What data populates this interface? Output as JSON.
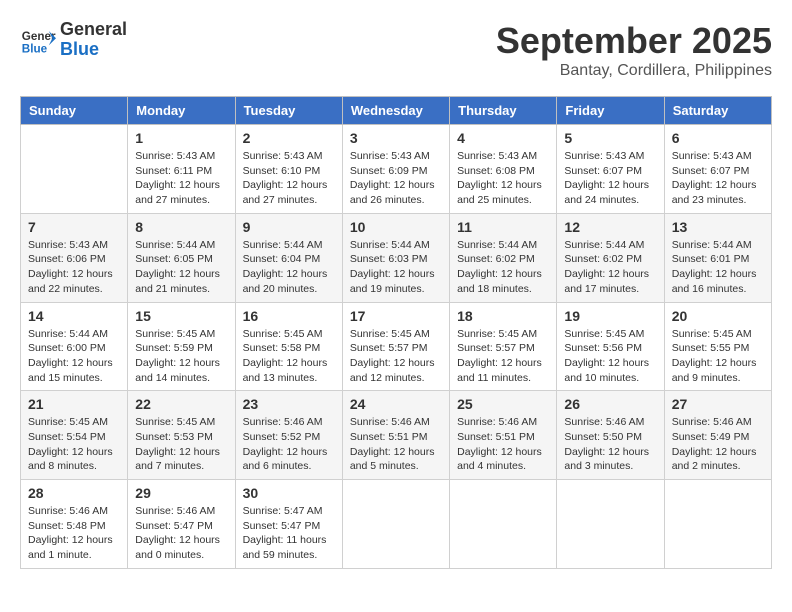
{
  "logo": {
    "text_general": "General",
    "text_blue": "Blue"
  },
  "header": {
    "month": "September 2025",
    "location": "Bantay, Cordillera, Philippines"
  },
  "days_of_week": [
    "Sunday",
    "Monday",
    "Tuesday",
    "Wednesday",
    "Thursday",
    "Friday",
    "Saturday"
  ],
  "weeks": [
    [
      {
        "day": "",
        "sunrise": "",
        "sunset": "",
        "daylight": "",
        "empty": true
      },
      {
        "day": "1",
        "sunrise": "Sunrise: 5:43 AM",
        "sunset": "Sunset: 6:11 PM",
        "daylight": "Daylight: 12 hours and 27 minutes."
      },
      {
        "day": "2",
        "sunrise": "Sunrise: 5:43 AM",
        "sunset": "Sunset: 6:10 PM",
        "daylight": "Daylight: 12 hours and 27 minutes."
      },
      {
        "day": "3",
        "sunrise": "Sunrise: 5:43 AM",
        "sunset": "Sunset: 6:09 PM",
        "daylight": "Daylight: 12 hours and 26 minutes."
      },
      {
        "day": "4",
        "sunrise": "Sunrise: 5:43 AM",
        "sunset": "Sunset: 6:08 PM",
        "daylight": "Daylight: 12 hours and 25 minutes."
      },
      {
        "day": "5",
        "sunrise": "Sunrise: 5:43 AM",
        "sunset": "Sunset: 6:07 PM",
        "daylight": "Daylight: 12 hours and 24 minutes."
      },
      {
        "day": "6",
        "sunrise": "Sunrise: 5:43 AM",
        "sunset": "Sunset: 6:07 PM",
        "daylight": "Daylight: 12 hours and 23 minutes."
      }
    ],
    [
      {
        "day": "7",
        "sunrise": "Sunrise: 5:43 AM",
        "sunset": "Sunset: 6:06 PM",
        "daylight": "Daylight: 12 hours and 22 minutes."
      },
      {
        "day": "8",
        "sunrise": "Sunrise: 5:44 AM",
        "sunset": "Sunset: 6:05 PM",
        "daylight": "Daylight: 12 hours and 21 minutes."
      },
      {
        "day": "9",
        "sunrise": "Sunrise: 5:44 AM",
        "sunset": "Sunset: 6:04 PM",
        "daylight": "Daylight: 12 hours and 20 minutes."
      },
      {
        "day": "10",
        "sunrise": "Sunrise: 5:44 AM",
        "sunset": "Sunset: 6:03 PM",
        "daylight": "Daylight: 12 hours and 19 minutes."
      },
      {
        "day": "11",
        "sunrise": "Sunrise: 5:44 AM",
        "sunset": "Sunset: 6:02 PM",
        "daylight": "Daylight: 12 hours and 18 minutes."
      },
      {
        "day": "12",
        "sunrise": "Sunrise: 5:44 AM",
        "sunset": "Sunset: 6:02 PM",
        "daylight": "Daylight: 12 hours and 17 minutes."
      },
      {
        "day": "13",
        "sunrise": "Sunrise: 5:44 AM",
        "sunset": "Sunset: 6:01 PM",
        "daylight": "Daylight: 12 hours and 16 minutes."
      }
    ],
    [
      {
        "day": "14",
        "sunrise": "Sunrise: 5:44 AM",
        "sunset": "Sunset: 6:00 PM",
        "daylight": "Daylight: 12 hours and 15 minutes."
      },
      {
        "day": "15",
        "sunrise": "Sunrise: 5:45 AM",
        "sunset": "Sunset: 5:59 PM",
        "daylight": "Daylight: 12 hours and 14 minutes."
      },
      {
        "day": "16",
        "sunrise": "Sunrise: 5:45 AM",
        "sunset": "Sunset: 5:58 PM",
        "daylight": "Daylight: 12 hours and 13 minutes."
      },
      {
        "day": "17",
        "sunrise": "Sunrise: 5:45 AM",
        "sunset": "Sunset: 5:57 PM",
        "daylight": "Daylight: 12 hours and 12 minutes."
      },
      {
        "day": "18",
        "sunrise": "Sunrise: 5:45 AM",
        "sunset": "Sunset: 5:57 PM",
        "daylight": "Daylight: 12 hours and 11 minutes."
      },
      {
        "day": "19",
        "sunrise": "Sunrise: 5:45 AM",
        "sunset": "Sunset: 5:56 PM",
        "daylight": "Daylight: 12 hours and 10 minutes."
      },
      {
        "day": "20",
        "sunrise": "Sunrise: 5:45 AM",
        "sunset": "Sunset: 5:55 PM",
        "daylight": "Daylight: 12 hours and 9 minutes."
      }
    ],
    [
      {
        "day": "21",
        "sunrise": "Sunrise: 5:45 AM",
        "sunset": "Sunset: 5:54 PM",
        "daylight": "Daylight: 12 hours and 8 minutes."
      },
      {
        "day": "22",
        "sunrise": "Sunrise: 5:45 AM",
        "sunset": "Sunset: 5:53 PM",
        "daylight": "Daylight: 12 hours and 7 minutes."
      },
      {
        "day": "23",
        "sunrise": "Sunrise: 5:46 AM",
        "sunset": "Sunset: 5:52 PM",
        "daylight": "Daylight: 12 hours and 6 minutes."
      },
      {
        "day": "24",
        "sunrise": "Sunrise: 5:46 AM",
        "sunset": "Sunset: 5:51 PM",
        "daylight": "Daylight: 12 hours and 5 minutes."
      },
      {
        "day": "25",
        "sunrise": "Sunrise: 5:46 AM",
        "sunset": "Sunset: 5:51 PM",
        "daylight": "Daylight: 12 hours and 4 minutes."
      },
      {
        "day": "26",
        "sunrise": "Sunrise: 5:46 AM",
        "sunset": "Sunset: 5:50 PM",
        "daylight": "Daylight: 12 hours and 3 minutes."
      },
      {
        "day": "27",
        "sunrise": "Sunrise: 5:46 AM",
        "sunset": "Sunset: 5:49 PM",
        "daylight": "Daylight: 12 hours and 2 minutes."
      }
    ],
    [
      {
        "day": "28",
        "sunrise": "Sunrise: 5:46 AM",
        "sunset": "Sunset: 5:48 PM",
        "daylight": "Daylight: 12 hours and 1 minute."
      },
      {
        "day": "29",
        "sunrise": "Sunrise: 5:46 AM",
        "sunset": "Sunset: 5:47 PM",
        "daylight": "Daylight: 12 hours and 0 minutes."
      },
      {
        "day": "30",
        "sunrise": "Sunrise: 5:47 AM",
        "sunset": "Sunset: 5:47 PM",
        "daylight": "Daylight: 11 hours and 59 minutes."
      },
      {
        "day": "",
        "sunrise": "",
        "sunset": "",
        "daylight": "",
        "empty": true
      },
      {
        "day": "",
        "sunrise": "",
        "sunset": "",
        "daylight": "",
        "empty": true
      },
      {
        "day": "",
        "sunrise": "",
        "sunset": "",
        "daylight": "",
        "empty": true
      },
      {
        "day": "",
        "sunrise": "",
        "sunset": "",
        "daylight": "",
        "empty": true
      }
    ]
  ]
}
